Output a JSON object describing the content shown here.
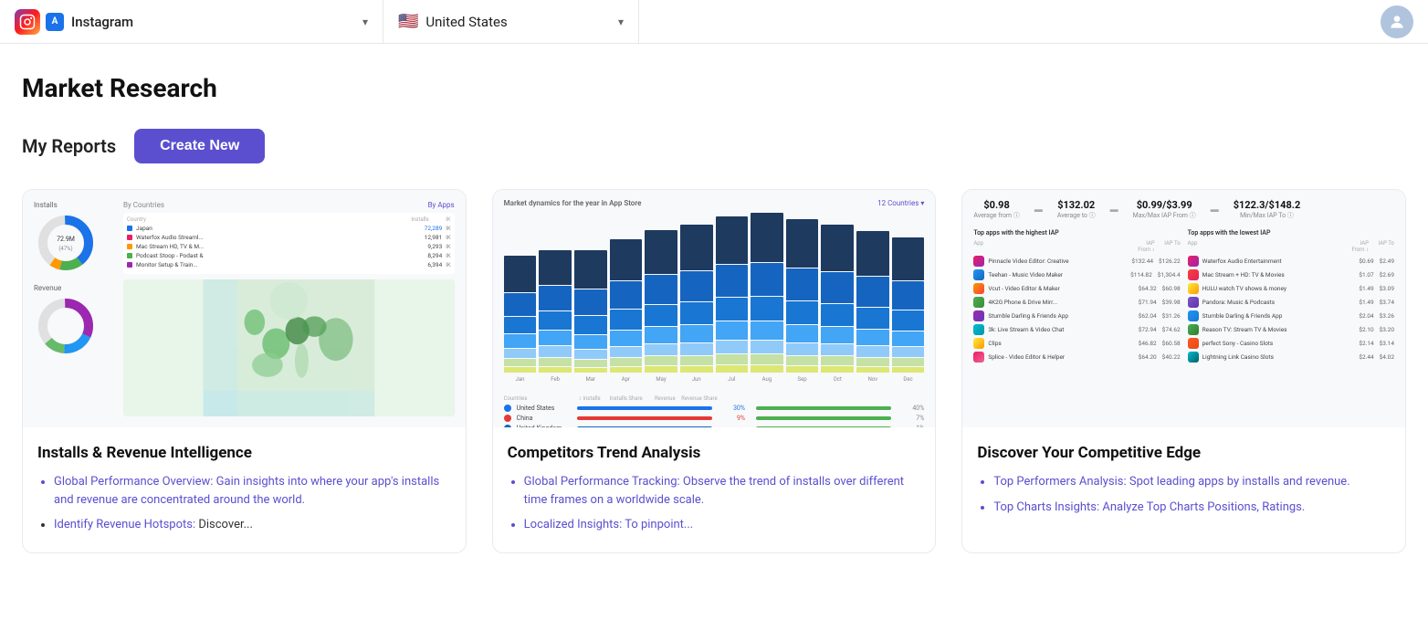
{
  "topbar": {
    "app_name": "Instagram",
    "app_icon_emoji": "📷",
    "appstore_label": "A",
    "chevron": "▾",
    "country": "United States",
    "flag_emoji": "🇺🇸"
  },
  "page": {
    "title": "Market Research",
    "my_reports_label": "My Reports",
    "create_new_label": "Create New"
  },
  "cards": [
    {
      "id": "installs-revenue",
      "title": "Installs & Revenue Intelligence",
      "bullets": [
        {
          "highlight": "Global Performance Overview:",
          "rest": " Gain insights into where your app's installs and revenue are concentrated around the world."
        },
        {
          "highlight": "Identify Revenue Hotspots:",
          "rest": " Discover..."
        }
      ]
    },
    {
      "id": "competitors-trend",
      "title": "Competitors Trend Analysis",
      "bullets": [
        {
          "highlight": "Global Performance Tracking:",
          "rest": " Observe the trend of installs over different time frames on a worldwide scale."
        },
        {
          "highlight": "Localized Insights:",
          "rest": " To pinpoint..."
        }
      ]
    },
    {
      "id": "competitive-edge",
      "title": "Discover Your Competitive Edge",
      "bullets": [
        {
          "highlight": "Top Performers Analysis:",
          "rest": " Spot leading apps by installs and revenue."
        },
        {
          "highlight": "Top Charts Insights:",
          "rest": " Analyze Top Charts Positions, Ratings."
        }
      ]
    }
  ],
  "card3_metrics": {
    "avg_from": "$0.98",
    "avg_from_lbl": "Average from ⓘ",
    "avg_to": "$132.02",
    "avg_to_lbl": "Average to ⓘ",
    "max_iap_from": "$0.99/$3.99",
    "max_iap_from_lbl": "Max/Max IAP From ⓘ",
    "min_iap_to": "$122.3/$148.2",
    "min_iap_to_lbl": "Min/Max IAP To ⓘ"
  }
}
